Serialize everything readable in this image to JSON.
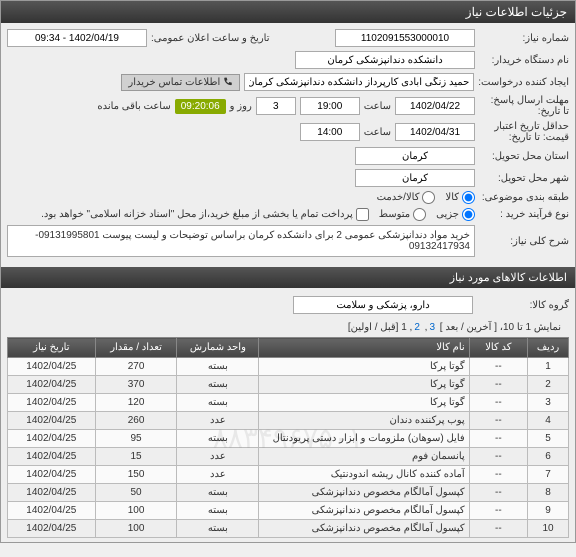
{
  "header": {
    "title": "جزئیات اطلاعات نیاز"
  },
  "form": {
    "need_number_label": "شماره نیاز:",
    "need_number": "1102091553000010",
    "announce_datetime_label": "تاریخ و ساعت اعلان عمومی:",
    "announce_datetime": "1402/04/19 - 09:34",
    "buyer_org_label": "نام دستگاه خریدار:",
    "buyer_org": "دانشکده دندانپزشکی کرمان",
    "requester_label": "ایجاد کننده درخواست:",
    "requester": "حمید زنگی آبادی کارپرداز دانشکده دندانپزشکی کرمان",
    "contact_link": "اطلاعات تماس خریدار",
    "reply_deadline_label": "مهلت ارسال پاسخ:",
    "reply_deadline_date_label": "تا تاریخ:",
    "reply_deadline_date": "1402/04/22",
    "time_label": "ساعت",
    "reply_deadline_time": "19:00",
    "days": "3",
    "days_label": "روز و",
    "timer": "09:20:06",
    "remaining_label": "ساعت باقی مانده",
    "price_expiry_label": "حداقل تاریخ اعتبار",
    "price_expiry_sub": "قیمت: تا تاریخ:",
    "price_expiry_date": "1402/04/31",
    "price_expiry_time": "14:00",
    "province_label": "استان محل تحویل:",
    "province": "کرمان",
    "city_label": "شهر محل تحویل:",
    "city": "کرمان",
    "subject_label": "طبقه بندی موضوعی:",
    "subject_good": "کالا",
    "subject_service": "کالا/خدمت",
    "purchase_type_label": "نوع فرآیند خرید :",
    "pt_minor": "جزیی",
    "pt_medium": "متوسط",
    "payment_note": "پرداخت تمام یا بخشی از مبلغ خرید،از محل \"اسناد خزانه اسلامی\" خواهد بود.",
    "desc_label": "شرح کلی نیاز:",
    "desc": "خرید مواد دندانپزشکی عمومی 2 برای دانشکده کرمان براساس توضیحات و لیست پیوست 09131995801-09132417934"
  },
  "section2": {
    "title": "اطلاعات کالاهای مورد نیاز"
  },
  "group": {
    "label": "گروه کالا:",
    "value": "دارو، پزشکی و سلامت"
  },
  "nav": {
    "prefix": "نمایش 1 تا 10، [ آخرین / بعد ] ",
    "p3": "3",
    "p2": "2",
    "p1": "1",
    "suffix": " [قبل / اولین]"
  },
  "table": {
    "headers": {
      "row": "ردیف",
      "code": "کد کالا",
      "name": "نام کالا",
      "unit": "واحد شمارش",
      "qty": "تعداد / مقدار",
      "date": "تاریخ نیاز"
    },
    "rows": [
      {
        "n": "1",
        "code": "--",
        "name": "گوتا پرکا",
        "unit": "بسته",
        "qty": "270",
        "date": "1402/04/25"
      },
      {
        "n": "2",
        "code": "--",
        "name": "گوتا پرکا",
        "unit": "بسته",
        "qty": "370",
        "date": "1402/04/25"
      },
      {
        "n": "3",
        "code": "--",
        "name": "گوتا پرکا",
        "unit": "بسته",
        "qty": "120",
        "date": "1402/04/25"
      },
      {
        "n": "4",
        "code": "--",
        "name": "پوب پرکننده دندان",
        "unit": "عدد",
        "qty": "260",
        "date": "1402/04/25"
      },
      {
        "n": "5",
        "code": "--",
        "name": "فایل (سوهان) ملزومات و ابزار دستی پریودنتال",
        "unit": "بسته",
        "qty": "95",
        "date": "1402/04/25"
      },
      {
        "n": "6",
        "code": "--",
        "name": "پانسمان فوم",
        "unit": "عدد",
        "qty": "15",
        "date": "1402/04/25"
      },
      {
        "n": "7",
        "code": "--",
        "name": "آماده کننده کانال ریشه اندودنتیک",
        "unit": "عدد",
        "qty": "150",
        "date": "1402/04/25"
      },
      {
        "n": "8",
        "code": "--",
        "name": "کپسول آمالگام مخصوص دندانپزشکی",
        "unit": "بسته",
        "qty": "50",
        "date": "1402/04/25"
      },
      {
        "n": "9",
        "code": "--",
        "name": "کپسول آمالگام مخصوص دندانپزشکی",
        "unit": "بسته",
        "qty": "100",
        "date": "1402/04/25"
      },
      {
        "n": "10",
        "code": "--",
        "name": "کپسول آمالگام مخصوص دندانپزشکی",
        "unit": "بسته",
        "qty": "100",
        "date": "1402/04/25"
      }
    ]
  }
}
